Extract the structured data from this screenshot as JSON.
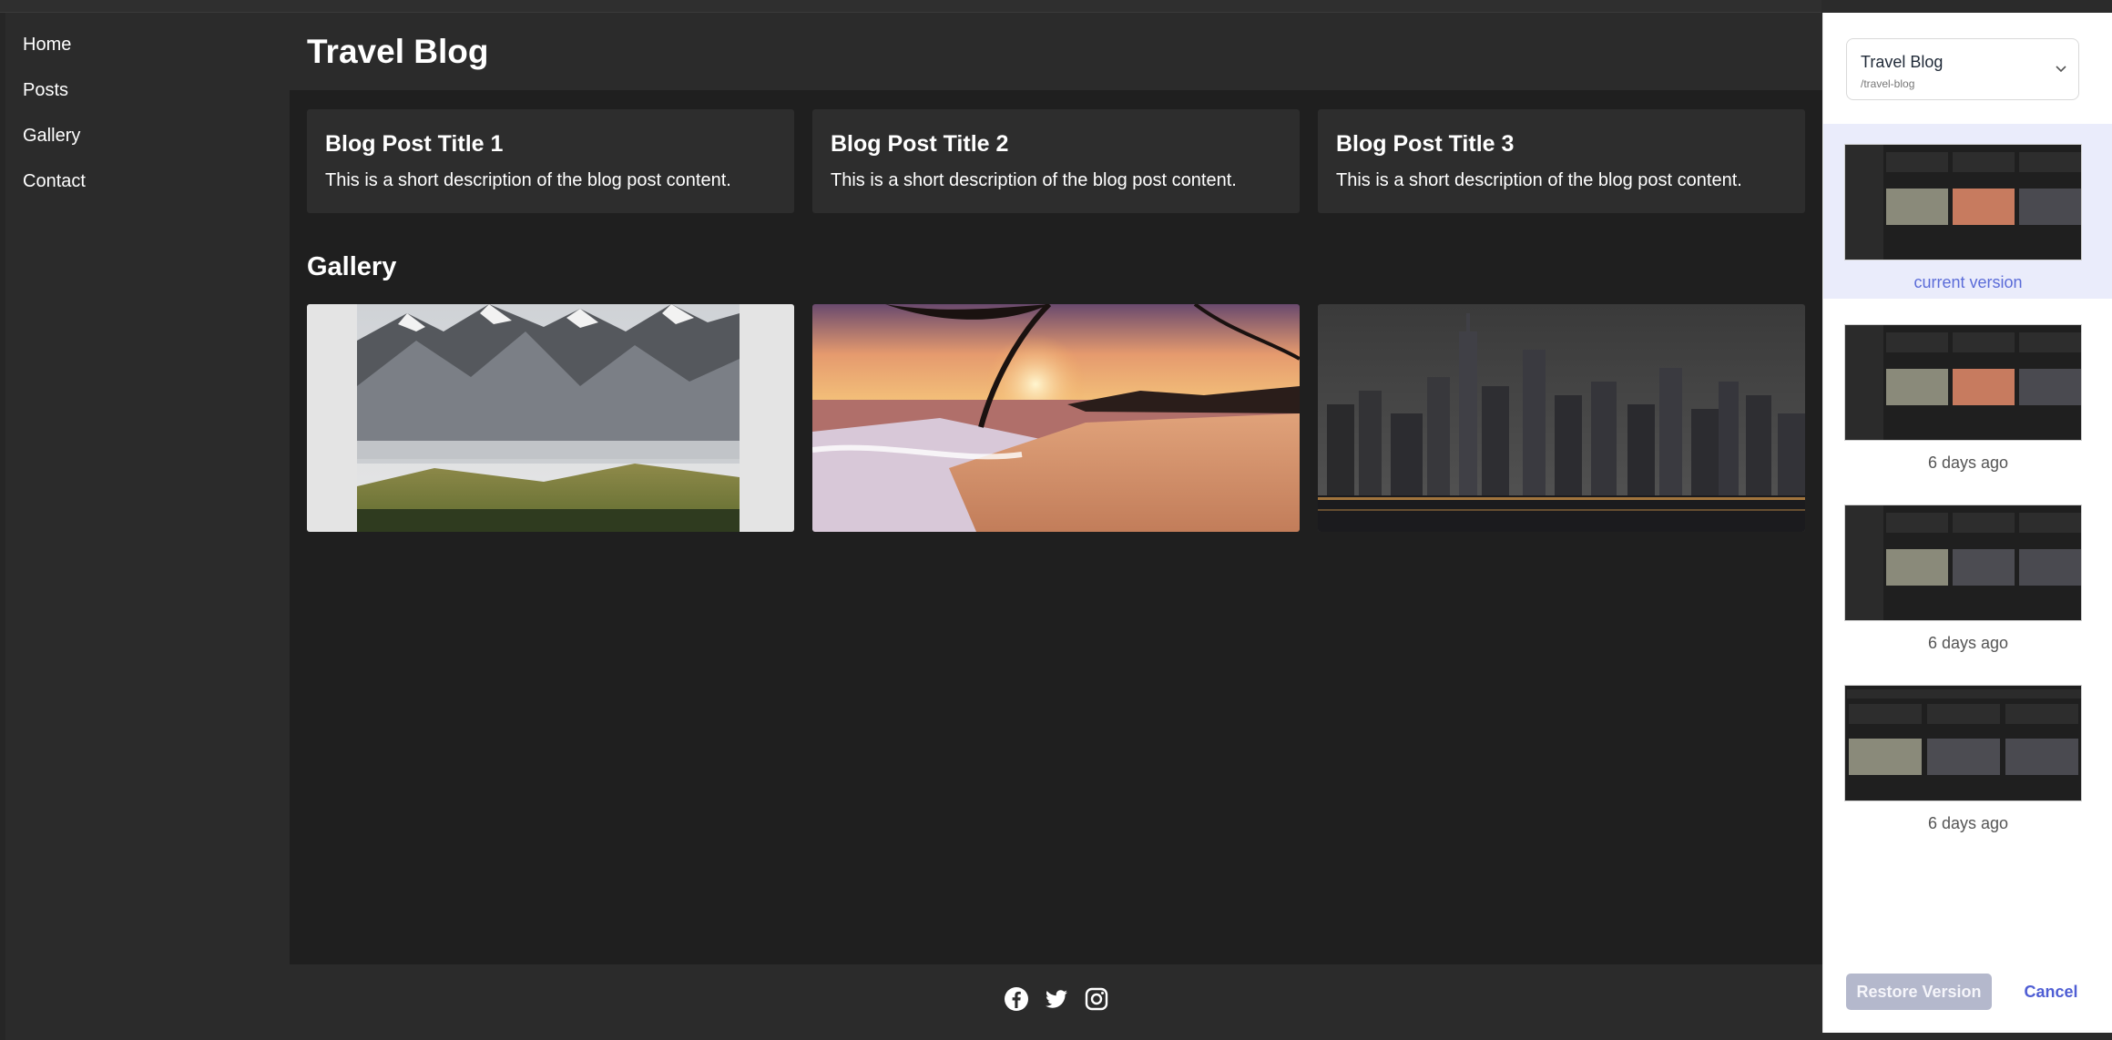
{
  "sidebar": {
    "items": [
      {
        "label": "Home"
      },
      {
        "label": "Posts"
      },
      {
        "label": "Gallery"
      },
      {
        "label": "Contact"
      }
    ]
  },
  "header": {
    "title": "Travel Blog"
  },
  "posts": [
    {
      "title": "Blog Post Title 1",
      "description": "This is a short description of the blog post content."
    },
    {
      "title": "Blog Post Title 2",
      "description": "This is a short description of the blog post content."
    },
    {
      "title": "Blog Post Title 3",
      "description": "This is a short description of the blog post content."
    }
  ],
  "gallery": {
    "title": "Gallery",
    "images": [
      {
        "subject": "mountain landscape"
      },
      {
        "subject": "beach sunset"
      },
      {
        "subject": "city skyline at night"
      }
    ]
  },
  "footer": {
    "icons": [
      "facebook-icon",
      "twitter-icon",
      "instagram-icon"
    ]
  },
  "history_panel": {
    "project_name": "Travel Blog",
    "project_path": "/travel-blog",
    "versions": [
      {
        "label": "current version"
      },
      {
        "label": "6 days ago"
      },
      {
        "label": "6 days ago"
      },
      {
        "label": "6 days ago"
      }
    ],
    "restore_label": "Restore Version",
    "cancel_label": "Cancel"
  },
  "colors": {
    "accent": "#5b6cd8",
    "current_version_bg": "#eaecfb",
    "main_bg": "#1f1f1f",
    "sidebar_bg": "#2b2b2b"
  }
}
